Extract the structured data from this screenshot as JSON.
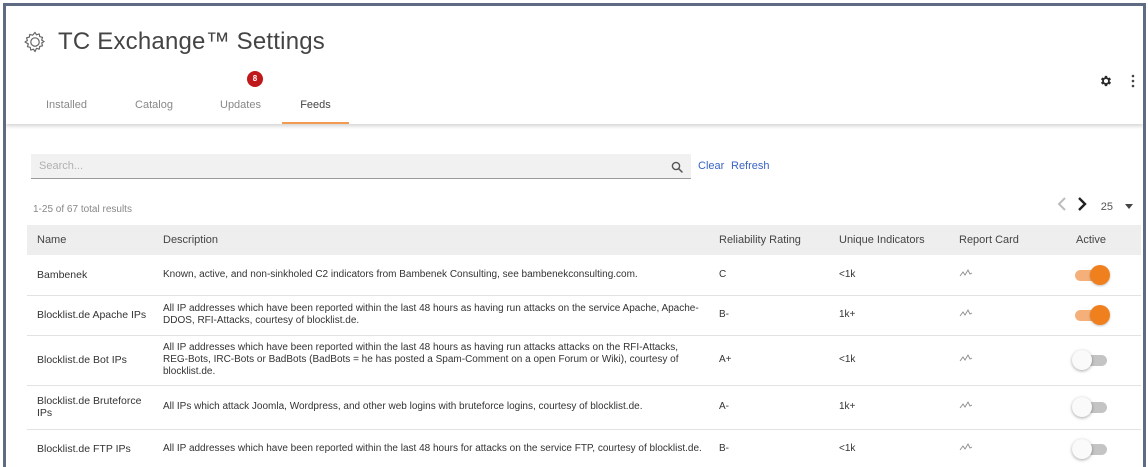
{
  "app": {
    "title": "TC Exchange™ Settings"
  },
  "tabs": [
    {
      "label": "Installed"
    },
    {
      "label": "Catalog"
    },
    {
      "label": "Updates",
      "badge": "8"
    },
    {
      "label": "Feeds",
      "active": true
    }
  ],
  "icons": {
    "title": "gear-outline-icon",
    "settings": "gear-icon",
    "menu": "kebab-menu-icon",
    "search": "search-icon",
    "prev": "chevron-left-icon",
    "next": "chevron-right-icon",
    "report_card": "report-card-icon"
  },
  "colors": {
    "accent": "#f07f1e",
    "badge": "#c0191b",
    "link": "#3a63c4"
  },
  "search": {
    "placeholder": "Search...",
    "value": ""
  },
  "actions": {
    "clear": "Clear",
    "refresh": "Refresh"
  },
  "results_text": "1-25 of 67 total results",
  "pagination": {
    "page_size": "25"
  },
  "table": {
    "headers": {
      "name": "Name",
      "description": "Description",
      "reliability": "Reliability Rating",
      "unique": "Unique Indicators",
      "report_card": "Report Card",
      "active": "Active"
    },
    "rows": [
      {
        "name": "Bambenek",
        "description": "Known, active, and non-sinkholed C2 indicators from Bambenek Consulting, see bambenekconsulting.com.",
        "reliability": "C",
        "unique": "<1k",
        "active": true
      },
      {
        "name": "Blocklist.de Apache IPs",
        "description": "All IP addresses which have been reported within the last 48 hours as having run attacks on the service Apache, Apache-DDOS, RFI-Attacks, courtesy of blocklist.de.",
        "reliability": "B-",
        "unique": "1k+",
        "active": true
      },
      {
        "name": "Blocklist.de Bot IPs",
        "description": "All IP addresses which have been reported within the last 48 hours as having run attacks attacks on the RFI-Attacks, REG-Bots, IRC-Bots or BadBots (BadBots = he has posted a Spam-Comment on a open Forum or Wiki), courtesy of blocklist.de.",
        "reliability": "A+",
        "unique": "<1k",
        "active": false
      },
      {
        "name": "Blocklist.de Bruteforce IPs",
        "description": "All IPs which attack Joomla, Wordpress, and other web logins with bruteforce logins, courtesy of blocklist.de.",
        "reliability": "A-",
        "unique": "1k+",
        "active": false
      },
      {
        "name": "Blocklist.de FTP IPs",
        "description": "All IP addresses which have been reported within the last 48 hours for attacks on the service FTP, courtesy of blocklist.de.",
        "reliability": "B-",
        "unique": "<1k",
        "active": false
      }
    ]
  }
}
